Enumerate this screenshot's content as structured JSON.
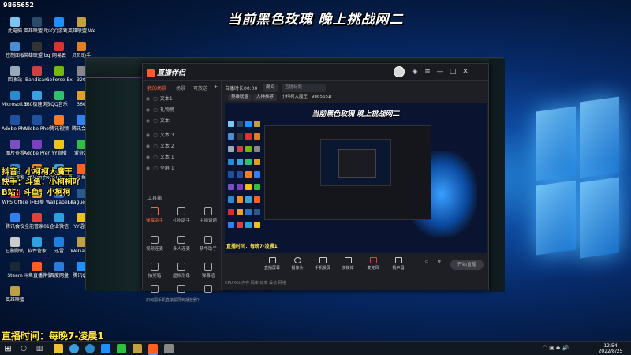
{
  "overlay": {
    "title": "当前黑色玫瑰 晚上挑战网二",
    "promo_lines": [
      "抖音：小柯柯大魔王",
      "快手：斗鱼，小柯柯吖",
      "B站：斗鱼，小柯柯"
    ],
    "schedule": "直播时间：每晚7-凌晨1",
    "top_left": "9865652"
  },
  "desktop_icons": [
    {
      "label": "此电脑",
      "color": "#7cc4f2"
    },
    {
      "label": "英雄联盟 助手",
      "color": "#2a4a6a"
    },
    {
      "label": "QQ游戏",
      "color": "#1e90ff"
    },
    {
      "label": "英雄联盟 WeGame",
      "color": "#c0a040"
    },
    {
      "label": "控制面板",
      "color": "#4a90d0"
    },
    {
      "label": "英雄联盟 bgm",
      "color": "#333"
    },
    {
      "label": "网易云",
      "color": "#e03030"
    },
    {
      "label": "贝贝助手",
      "color": "#e08020"
    },
    {
      "label": "回收站",
      "color": "#9ab"
    },
    {
      "label": "Bandicam",
      "color": "#d04040"
    },
    {
      "label": "GeForce Experience",
      "color": "#76b900"
    },
    {
      "label": "320",
      "color": "#888"
    },
    {
      "label": "Microsoft Edge",
      "color": "#2a8ad0"
    },
    {
      "label": "360极速浏览器",
      "color": "#3aa0e0"
    },
    {
      "label": "QQ音乐",
      "color": "#30c070"
    },
    {
      "label": "360",
      "color": "#e0a020"
    },
    {
      "label": "Adobe Photosh...",
      "color": "#2050a0"
    },
    {
      "label": "Adobe Photosh...",
      "color": "#2050a0"
    },
    {
      "label": "腾讯视频",
      "color": "#ff7a20"
    },
    {
      "label": "腾讯会议",
      "color": "#3080f0"
    },
    {
      "label": "图片查看",
      "color": "#7a50c0"
    },
    {
      "label": "Adobe Premiere",
      "color": "#7a40c0"
    },
    {
      "label": "YY直播",
      "color": "#f0c020"
    },
    {
      "label": "爱奇艺",
      "color": "#30c040"
    },
    {
      "label": "电脑管家",
      "color": "#2a8ad0"
    },
    {
      "label": "虎牙助手",
      "color": "#f09020"
    },
    {
      "label": "ROFL小工具",
      "color": "#40a0d0"
    },
    {
      "label": "斗鱼",
      "color": "#ff6020"
    },
    {
      "label": "WPS Office",
      "color": "#d03030"
    },
    {
      "label": "向日葵",
      "color": "#f0a030"
    },
    {
      "label": "Wallpaper Engine",
      "color": "#3070c0"
    },
    {
      "label": "LeagueDir...",
      "color": "#2a5a8a"
    },
    {
      "label": "腾讯会议",
      "color": "#3080f0"
    },
    {
      "label": "全能管家01",
      "color": "#e04040"
    },
    {
      "label": "企业微信",
      "color": "#2aa0e0"
    },
    {
      "label": "YY语音",
      "color": "#f0c020"
    },
    {
      "label": "已删除的",
      "color": "#ccc"
    },
    {
      "label": "软件管家",
      "color": "#30a0e0"
    },
    {
      "label": "迅雷",
      "color": "#1e80e0"
    },
    {
      "label": "WeGame",
      "color": "#c0a040"
    },
    {
      "label": "Steam",
      "color": "#1b2838"
    },
    {
      "label": "斗鱼直播伴侣",
      "color": "#ff6020"
    },
    {
      "label": "百度网盘",
      "color": "#2a7ae0"
    },
    {
      "label": "腾讯QQ",
      "color": "#1e90ff"
    },
    {
      "label": "英雄联盟",
      "color": "#c0a040"
    }
  ],
  "app": {
    "name": "直播伴侣",
    "left_tabs": [
      "我的场景",
      "场景",
      "可放送"
    ],
    "layers": [
      "文本1",
      "礼物榜",
      "文本",
      "文本 3",
      "文本 2",
      "文本 1",
      "全屏 1"
    ],
    "tools_header": "工具箱",
    "tools": [
      "弹幕助手",
      "礼物助手",
      "主播话题",
      "视频连麦",
      "多人连麦",
      "精华助手",
      "抽奖箱",
      "虚拟形象",
      "弹幕墙",
      "—",
      "—",
      "—"
    ],
    "tip": "如何把手机直接投屏到播放器？",
    "stream_header": "自播时长00:00",
    "room_label": "房间",
    "room_placeholder": "直播标题",
    "room_tag": "英雄联盟",
    "rank_tag": "大神推荐",
    "streamer": "小柯柯大魔王",
    "room_id": "9865652",
    "likes": "0",
    "preview_title": "当前黑色玫瑰 晚上挑战网二",
    "preview_schedule": "直播时间：每晚7-凌晨1",
    "controls": [
      "直播屏幕",
      "摄像头",
      "手机投屏",
      "多媒体",
      "麦克风",
      "扬声器"
    ],
    "start_live": "开始直播",
    "status": "CPU 0%   内存   码率   帧率   丢帧   网络"
  },
  "taskbar": {
    "time": "12:54",
    "date": "2022/8/25"
  }
}
